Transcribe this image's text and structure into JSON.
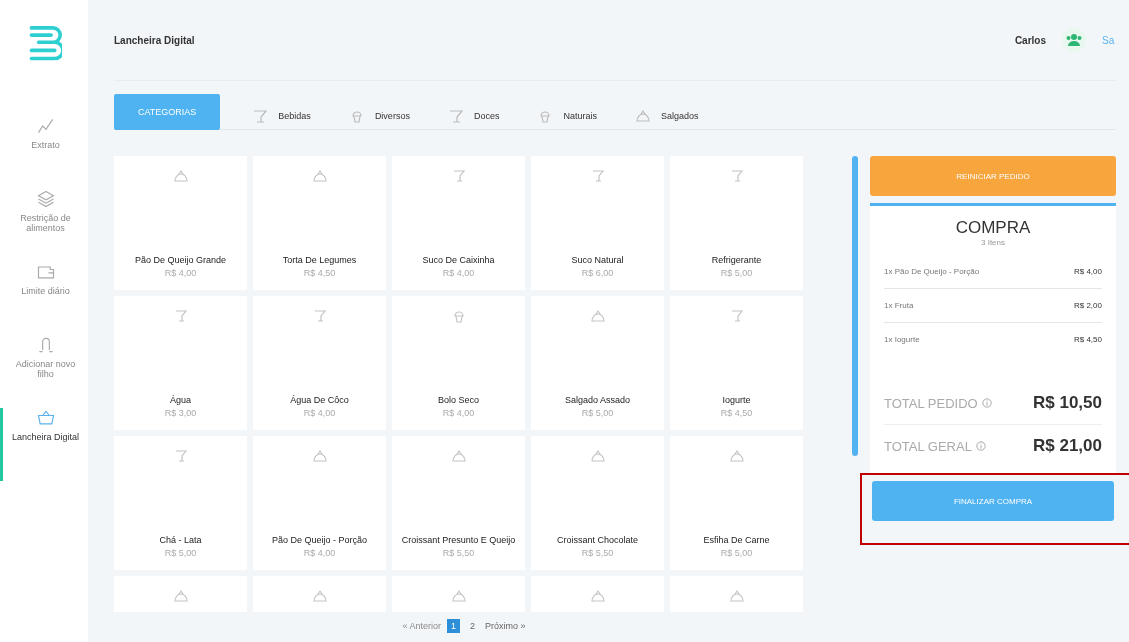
{
  "sidebar": {
    "items": [
      {
        "label": "Extrato",
        "selected": false
      },
      {
        "label": "Restrição de alimentos",
        "selected": false
      },
      {
        "label": "Limite diário",
        "selected": false
      },
      {
        "label": "Adicionar novo filho",
        "selected": false
      },
      {
        "label": "Lancheira Digital",
        "selected": true
      }
    ]
  },
  "header": {
    "title": "Lancheira Digital",
    "user": "Carlos",
    "logout": "Sa"
  },
  "tabs": [
    {
      "label": "CATEGORIAS",
      "kind": "all",
      "selected": true
    },
    {
      "label": "Bebidas",
      "kind": "drink",
      "selected": false
    },
    {
      "label": "Diversos",
      "kind": "sweet",
      "selected": false
    },
    {
      "label": "Doces",
      "kind": "drink",
      "selected": false
    },
    {
      "label": "Naturais",
      "kind": "sweet",
      "selected": false
    },
    {
      "label": "Salgados",
      "kind": "savory",
      "selected": false
    }
  ],
  "products": [
    {
      "name": "Pão De Queijo Grande",
      "price": "R$ 4,00",
      "kind": "savory"
    },
    {
      "name": "Torta De Legumes",
      "price": "R$ 4,50",
      "kind": "savory"
    },
    {
      "name": "Suco De Caixinha",
      "price": "R$ 4,00",
      "kind": "drink"
    },
    {
      "name": "Suco Natural",
      "price": "R$ 6,00",
      "kind": "drink"
    },
    {
      "name": "Refrigerante",
      "price": "R$ 5,00",
      "kind": "drink"
    },
    {
      "name": "Água",
      "price": "R$ 3,00",
      "kind": "drink"
    },
    {
      "name": "Água De Côco",
      "price": "R$ 4,00",
      "kind": "drink"
    },
    {
      "name": "Bolo Seco",
      "price": "R$ 4,00",
      "kind": "sweet"
    },
    {
      "name": "Salgado Assado",
      "price": "R$ 5,00",
      "kind": "savory"
    },
    {
      "name": "Iogurte",
      "price": "R$ 4,50",
      "kind": "drink"
    },
    {
      "name": "Chá - Lata",
      "price": "R$ 5,00",
      "kind": "drink"
    },
    {
      "name": "Pão De Queijo - Porção",
      "price": "R$ 4,00",
      "kind": "savory"
    },
    {
      "name": "Croissant Presunto E Queijo",
      "price": "R$ 5,50",
      "kind": "savory"
    },
    {
      "name": "Croissant Chocolate",
      "price": "R$ 5,50",
      "kind": "savory"
    },
    {
      "name": "Esfiha De Carne",
      "price": "R$ 5,00",
      "kind": "savory"
    },
    {
      "kind": "savory"
    },
    {
      "kind": "savory"
    },
    {
      "kind": "savory"
    },
    {
      "kind": "savory"
    },
    {
      "kind": "savory"
    }
  ],
  "pagination": {
    "previous": "« Anterior",
    "pages": [
      {
        "label": "1",
        "selected": true
      },
      {
        "label": "2",
        "selected": false
      }
    ],
    "next": "Próximo »"
  },
  "order": {
    "reset_button": "REINICIAR PEDIDO",
    "title": "COMPRA",
    "count": "3 Itens",
    "items": [
      {
        "name": "1x Pão De Queijo - Porção",
        "price": "R$ 4,00"
      },
      {
        "name": "1x Fruta",
        "price": "R$ 2,00"
      },
      {
        "name": "1x Iogurte",
        "price": "R$ 4,50"
      }
    ],
    "totals": [
      {
        "label": "TOTAL PEDIDO",
        "value": "R$ 10,50"
      },
      {
        "label": "TOTAL GERAL",
        "value": "R$ 21,00"
      }
    ],
    "finish_button": "FINALIZAR COMPRA"
  }
}
